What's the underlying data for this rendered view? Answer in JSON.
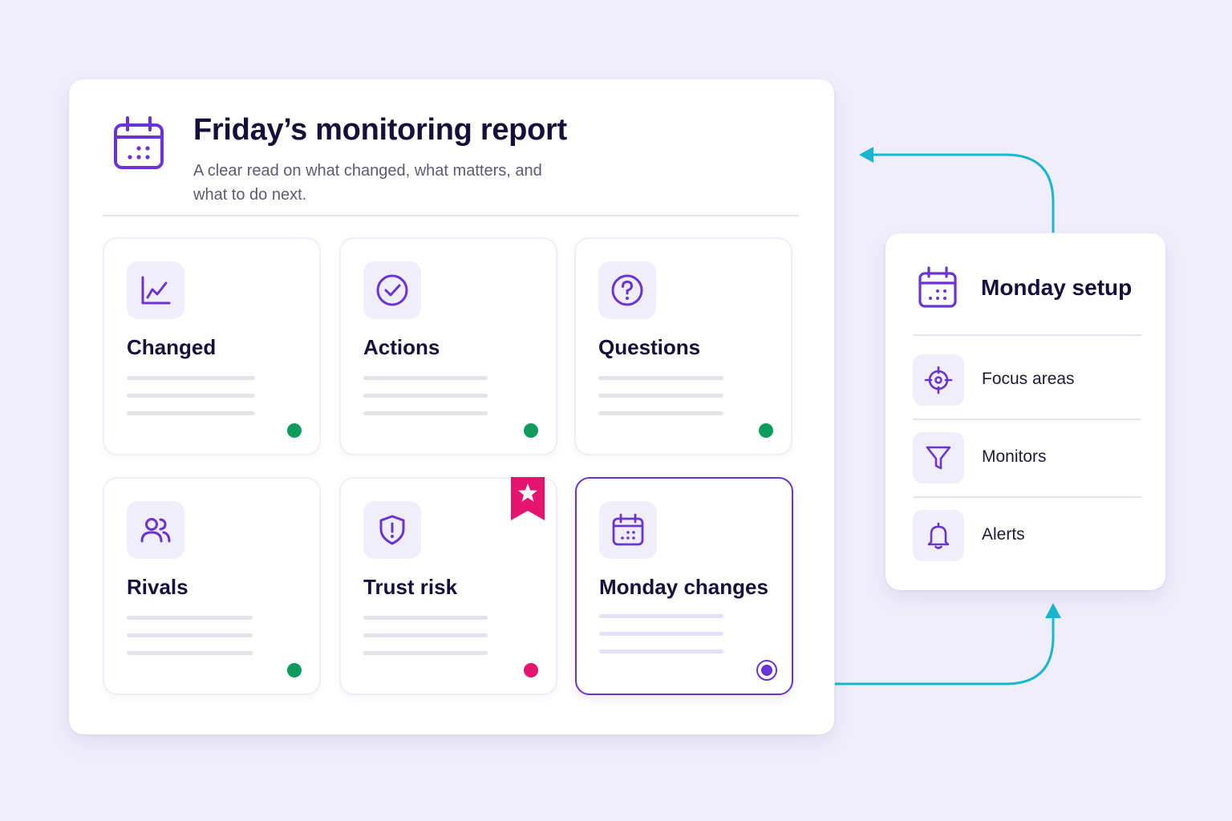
{
  "colors": {
    "background": "#f1eefc",
    "accent": "#6a34d4",
    "connector": "#19b6cf",
    "status_green": "#0d9c5c",
    "status_pink": "#e6136f",
    "heading": "#150f3d"
  },
  "report": {
    "title": "Friday’s monitoring report",
    "subtitle": "A clear read on what changed, what matters, and what to do next.",
    "icon": "calendar-icon",
    "tiles": [
      {
        "label": "Changed",
        "icon": "line-chart-icon",
        "status": "green"
      },
      {
        "label": "Actions",
        "icon": "check-circle-icon",
        "status": "green"
      },
      {
        "label": "Questions",
        "icon": "question-circle-icon",
        "status": "green"
      },
      {
        "label": "Rivals",
        "icon": "users-icon",
        "status": "green"
      },
      {
        "label": "Trust risk",
        "icon": "shield-alert-icon",
        "status": "pink",
        "flag": "star-ribbon-icon"
      },
      {
        "label": "Monday changes",
        "icon": "calendar-icon",
        "status": "selected"
      }
    ]
  },
  "setup": {
    "title": "Monday setup",
    "icon": "calendar-icon",
    "items": [
      {
        "label": "Focus areas",
        "icon": "crosshair-icon"
      },
      {
        "label": "Monitors",
        "icon": "filter-icon"
      },
      {
        "label": "Alerts",
        "icon": "bell-icon"
      }
    ]
  }
}
